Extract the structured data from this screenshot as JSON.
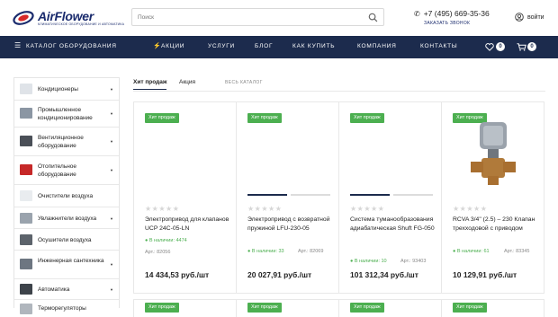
{
  "header": {
    "logo_text": "AirFlower",
    "logo_sub": "КЛИМАТИЧЕСКОЕ ОБОРУДОВАНИЕ И АВТОМАТИКА",
    "search_placeholder": "Поиск",
    "phone": "+7 (495) 669-35-36",
    "callback": "ЗАКАЗАТЬ ЗВОНОК",
    "login": "войти"
  },
  "nav": {
    "catalog": "КАТАЛОГ ОБОРУДОВАНИЯ",
    "sales": "АКЦИИ",
    "services": "УСЛУГИ",
    "blog": "БЛОГ",
    "how_to_buy": "КАК КУПИТЬ",
    "company": "КОМПАНИЯ",
    "contacts": "КОНТАКТЫ",
    "favorites_count": "0",
    "cart_count": "0"
  },
  "sidebar": {
    "items": [
      {
        "label": "Кондиционеры"
      },
      {
        "label": "Промышленное кондиционирование"
      },
      {
        "label": "Вентиляционное оборудование"
      },
      {
        "label": "Отопительное оборудование"
      },
      {
        "label": "Очистители воздуха"
      },
      {
        "label": "Увлажнители воздуха"
      },
      {
        "label": "Осушители воздуха"
      },
      {
        "label": "Инженерная сантехника"
      },
      {
        "label": "Автоматика"
      },
      {
        "label": "Терморегуляторы"
      }
    ]
  },
  "tabs": {
    "hit": "Хит продаж",
    "sale": "Акция",
    "all": "ВЕСЬ КАТАЛОГ"
  },
  "products": [
    {
      "badge": "Хит продаж",
      "name": "Электропривод для клапанов UCP 24C-05-LN",
      "stock": "В наличии: 4474",
      "art": "Арт.: 82056",
      "price": "14 434,53 руб./шт"
    },
    {
      "badge": "Хит продаж",
      "name": "Электропривод с возвратной пружиной LFU-230-05",
      "stock": "В наличии: 33",
      "art": "Арт.: 82069",
      "price": "20 027,91 руб./шт"
    },
    {
      "badge": "Хит продаж",
      "name": "Система туманообразования адиабатическая Shuft FG-050",
      "stock": "В наличии: 10",
      "art": "Арт.: 93403",
      "price": "101 312,34 руб./шт"
    },
    {
      "badge": "Хит продаж",
      "name": "RCVA 3/4\" (2.5) – 230 Клапан трехходовой с приводом",
      "stock": "В наличии: 61",
      "art": "Арт.: 83345",
      "price": "10 129,91 руб./шт"
    }
  ],
  "products_row2": [
    {
      "badge": "Хит продаж"
    },
    {
      "badge": "Хит продаж"
    },
    {
      "badge": "Хит продаж"
    },
    {
      "badge": "Хит продаж"
    }
  ],
  "colors": {
    "nav_bg": "#1c2b4d",
    "badge_green": "#4caf50",
    "brand_blue": "#1a2b6d"
  }
}
